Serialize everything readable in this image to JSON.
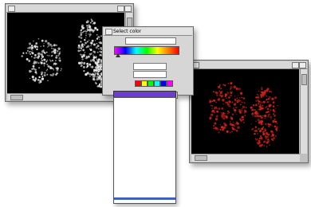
{
  "windows": {
    "left": {
      "title": ""
    },
    "right": {
      "title": ""
    }
  },
  "dialog": {
    "title": "Select color",
    "rows": {
      "top_label": "",
      "top_value": "",
      "mid_label": "",
      "mid_value": "",
      "low_label": "",
      "low_value": ""
    },
    "swatch_colors": [
      "#ff0000",
      "#ffff00",
      "#00ff00",
      "#00ffff",
      "#0000ff",
      "#ff00ff"
    ]
  },
  "dropdown": {
    "selected": "",
    "items": [
      "",
      "",
      "",
      "",
      "",
      "",
      "",
      "",
      "",
      "",
      "",
      "",
      "",
      "",
      "",
      "",
      "",
      "",
      "",
      "",
      "",
      "",
      "",
      "",
      "",
      "",
      "",
      "",
      "",
      "",
      "",
      "",
      ""
    ],
    "highlight_index": 32
  },
  "colors": {
    "accent": "#6b3fd0",
    "highlight": "#3a62b8",
    "left_dots": "#e8e8e8",
    "right_dots": "#d8231a"
  }
}
